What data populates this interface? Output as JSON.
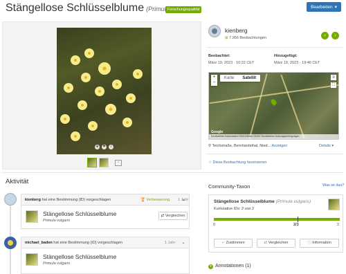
{
  "header": {
    "common_name": "Stängellose Schlüsselblume",
    "scientific_name": "(Primula vulgaris)",
    "quality_badge": "Forschungsqualität",
    "edit_label": "Bearbeiten"
  },
  "observer": {
    "username": "kienberg",
    "observation_count": "7.956 Beobachtungen"
  },
  "meta": {
    "observed_label": "Beobachtet:",
    "observed_value": "März 19, 2023 · 10:22 CET",
    "added_label": "Hinzugefügt:",
    "added_value": "März 19, 2023 · 19:46 CET"
  },
  "map": {
    "tab_map": "Karte",
    "tab_satellite": "Satellit",
    "google": "Google",
    "footer": "Kurzbefehle   Kartendaten ©2023 Bilder ©2023 TerraMetrics   Nutzungsbedingungen"
  },
  "location": {
    "text": "Teichstraße, Bernhardsthal, Nied...",
    "show_link": "Anzeigen",
    "details_link": "Details ▾"
  },
  "favorite_label": "Diese Beobachtung favorisieren",
  "activity": {
    "title": "Aktivität",
    "items": [
      {
        "user": "kienberg",
        "action": "hat eine Bestimmung (ID) vorgeschlagen",
        "tag": "Verbesserung",
        "time": "1 Jahr",
        "taxon_name": "Stängellose Schlüsselblume",
        "taxon_sci": "Primula vulgaris",
        "compare": "Vergleichen"
      },
      {
        "user": "michael_baden",
        "action": "hat eine Bestimmung (ID) vorgeschlagen",
        "time": "1 Jahr",
        "taxon_name": "Stängellose Schlüsselblume",
        "taxon_sci": "Primula vulgaris"
      }
    ]
  },
  "community_taxon": {
    "title": "Community-Taxon",
    "help_link": "Was ist das?",
    "name": "Stängellose Schlüsselblume",
    "sci": "(Primula vulgaris)",
    "cumulative_ids": "Kumulative IDs: 2 von 2",
    "agreement_fraction": 1.0,
    "tick_min": "0",
    "tick_mid": "2/3",
    "tick_max": "2",
    "btn_agree": "Zustimmen",
    "btn_compare": "Vergleichen",
    "btn_info": "Information"
  },
  "annotations_label": "Annotationen (1)",
  "colors": {
    "brand_green": "#74ac00",
    "link_blue": "#2f74b5"
  }
}
